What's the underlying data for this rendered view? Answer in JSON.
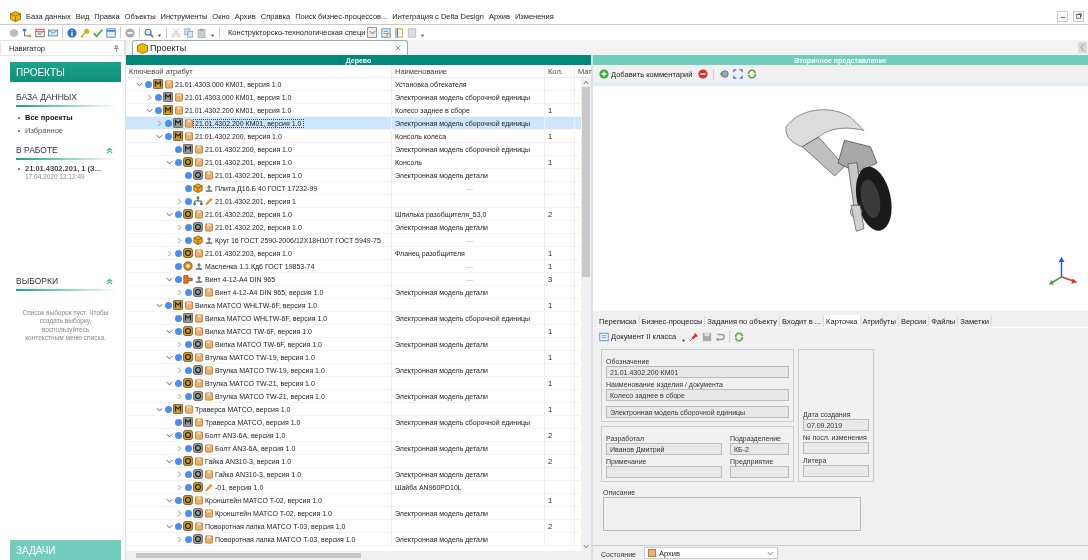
{
  "menu": [
    "База данных",
    "Вид",
    "Правка",
    "Объекты",
    "Инструменты",
    "Окно",
    "Архив",
    "Справка",
    "Поиск бизнес-процессов...",
    "Интеграция с Delta Design",
    "Архив",
    "Изменения"
  ],
  "toolbar": {
    "spec_select": "Конструкторско-технологическая специ"
  },
  "navigator": {
    "title": "Навигатор",
    "projects_header": "ПРОЕКТЫ",
    "database": {
      "title": "БАЗА ДАННЫХ",
      "items": [
        {
          "label": "Все проекты",
          "selected": true
        },
        {
          "label": "Избранное",
          "selected": false
        }
      ]
    },
    "in_work": {
      "title": "В РАБОТЕ",
      "items": [
        {
          "label": "21.01.4302.201, 1 (З...",
          "time": "17.04.2020 12:12:49"
        }
      ]
    },
    "selections": {
      "title": "ВЫБОРКИ",
      "empty_text": "Список выборок пуст. Чтобы создать выборку, воспользуйтесь контекстным меню списка."
    },
    "tasks_header": "ЗАДАЧИ"
  },
  "document_tab": {
    "title": "Проекты"
  },
  "tree": {
    "title": "Дерево",
    "columns": [
      "Ключевой атрибут",
      "Наименование",
      "Кол.",
      "Мат"
    ],
    "rows": [
      {
        "key": "21.01.4303.000 КМ01, версия 1.0",
        "name": "Установка обтекателя",
        "kind": "assembly",
        "expanded": true,
        "selected": false,
        "children": [
          {
            "key": "21.01.4303.000 КМ01, версия 1.0",
            "name": "Электронная модель сборочной единицы",
            "kind": "assembly-model",
            "expanded": false,
            "selected": false
          },
          {
            "key": "21.01.4302.200 КМ01, версия 1.0",
            "name": "Колесо заднее в сборе",
            "qty": "1",
            "kind": "assembly",
            "expanded": true,
            "selected": false,
            "children": [
              {
                "key": "21.01.4302.200 КМ01, версия 1.0",
                "name": "Электронная модель сборочной единицы",
                "kind": "assembly-model",
                "expanded": false,
                "selected": true
              },
              {
                "key": "21.01.4302.200, версия 1.0",
                "name": "Консоль колеса",
                "qty": "1",
                "kind": "assembly",
                "expanded": true,
                "selected": false,
                "children": [
                  {
                    "key": "21.01.4302.200, версия 1.0",
                    "name": "Электронная модель сборочной единицы",
                    "kind": "assembly-model",
                    "selected": false
                  },
                  {
                    "key": "21.01.4302.201, версия 1.0",
                    "name": "Консоль",
                    "qty": "1",
                    "kind": "part",
                    "expanded": true,
                    "selected": false,
                    "children": [
                      {
                        "key": "21.01.4302.201, версия 1.0",
                        "name": "Электронная модель детали",
                        "kind": "part-model",
                        "selected": false
                      },
                      {
                        "key": "Плита Д16.Б 40 ГОСТ 17232-99",
                        "name": "—",
                        "kind": "material",
                        "selected": false
                      },
                      {
                        "key": "21.01.4302.201, версия 1",
                        "kind": "structure",
                        "expanded": false,
                        "selected": false
                      }
                    ]
                  },
                  {
                    "key": "21.01.4302.202, версия 1.0",
                    "name": "Шпилька разобщителя_53,0",
                    "qty": "2",
                    "kind": "part",
                    "expanded": true,
                    "selected": false,
                    "children": [
                      {
                        "key": "21.01.4302.202, версия 1.0",
                        "name": "Электронная модель детали",
                        "kind": "part-model",
                        "expanded": false,
                        "selected": false
                      },
                      {
                        "key": "Круг 16 ГОСТ 2590-2006/12Х18Н10Т ГОСТ 5949-75",
                        "name": "—",
                        "kind": "material",
                        "expanded": false,
                        "selected": false
                      }
                    ]
                  },
                  {
                    "key": "21.01.4302.203, версия 1.0",
                    "name": "Фланец разобщителя",
                    "qty": "1",
                    "kind": "part",
                    "expanded": false,
                    "selected": false
                  },
                  {
                    "key": "Масленка 1.1.Кд6 ГОСТ 19853-74",
                    "name": "—",
                    "qty": "1",
                    "kind": "standard",
                    "selected": false
                  },
                  {
                    "key": "Винт 4-12-А4 DIN 965",
                    "name": "—",
                    "qty": "3",
                    "kind": "fastener",
                    "expanded": true,
                    "selected": false,
                    "children": [
                      {
                        "key": "Винт 4-12-А4 DIN 965, версия 1.0",
                        "name": "Электронная модель детали",
                        "kind": "part-model",
                        "expanded": false,
                        "selected": false
                      }
                    ]
                  }
                ]
              },
              {
                "key": "Вилка MATCO WHLTW-6F, версия 1.0",
                "qty": "1",
                "kind": "assembly",
                "expanded": true,
                "selected": false,
                "children": [
                  {
                    "key": "Вилка MATCO WHLTW-6F, версия 1.0",
                    "name": "Электронная модель сборочной единицы",
                    "kind": "assembly-model",
                    "selected": false
                  },
                  {
                    "key": "Вилка MATCO TW-6F, версия 1.0",
                    "qty": "1",
                    "kind": "part",
                    "expanded": true,
                    "selected": false,
                    "children": [
                      {
                        "key": "Вилка MATCO TW-6F, версия 1.0",
                        "name": "Электронная модель детали",
                        "kind": "part-model",
                        "expanded": false,
                        "selected": false
                      }
                    ]
                  },
                  {
                    "key": "Втулка MATCO TW-19, версия 1.0",
                    "qty": "1",
                    "kind": "part",
                    "expanded": true,
                    "selected": false,
                    "children": [
                      {
                        "key": "Втулка MATCO TW-19, версия 1.0",
                        "name": "Электронная модель детали",
                        "kind": "part-model",
                        "expanded": false,
                        "selected": false
                      }
                    ]
                  },
                  {
                    "key": "Втулка MATCO TW-21, версия 1.0",
                    "qty": "1",
                    "kind": "part",
                    "expanded": true,
                    "selected": false,
                    "children": [
                      {
                        "key": "Втулка MATCO TW-21, версия 1.0",
                        "name": "Электронная модель детали",
                        "kind": "part-model",
                        "expanded": false,
                        "selected": false
                      }
                    ]
                  }
                ]
              },
              {
                "key": "Траверса MATCO, версия 1.0",
                "qty": "1",
                "kind": "assembly",
                "expanded": true,
                "selected": false,
                "children": [
                  {
                    "key": "Траверса MATCO, версия 1.0",
                    "name": "Электронная модель сборочной единицы",
                    "kind": "assembly-model",
                    "selected": false
                  },
                  {
                    "key": "Болт AN3-6A, версия 1.0",
                    "qty": "2",
                    "kind": "part",
                    "expanded": true,
                    "selected": false,
                    "children": [
                      {
                        "key": "Болт AN3-6A, версия 1.0",
                        "name": "Электронная модель детали",
                        "kind": "part-model",
                        "expanded": false,
                        "selected": false
                      }
                    ]
                  },
                  {
                    "key": "Гайка AN310-3, версия 1.0",
                    "qty": "2",
                    "kind": "part",
                    "expanded": true,
                    "selected": false,
                    "children": [
                      {
                        "key": "Гайка AN310-3, версия 1.0",
                        "name": "Электронная модель детали",
                        "kind": "part-model",
                        "expanded": false,
                        "selected": false
                      },
                      {
                        "key": "-01, версия 1.0",
                        "name": "Шайба AN960PD10L",
                        "kind": "variant",
                        "expanded": false,
                        "selected": false
                      }
                    ]
                  },
                  {
                    "key": "Кронштейн MATCO T-02, версия 1.0",
                    "qty": "1",
                    "kind": "part",
                    "expanded": true,
                    "selected": false,
                    "children": [
                      {
                        "key": "Кронштейн MATCO T-02, версия 1.0",
                        "name": "Электронная модель детали",
                        "kind": "part-model",
                        "expanded": false,
                        "selected": false
                      }
                    ]
                  },
                  {
                    "key": "Поворотная лапка MATCO T-03, версия 1.0",
                    "qty": "2",
                    "kind": "part",
                    "expanded": true,
                    "selected": false,
                    "children": [
                      {
                        "key": "Поворотная лапка MATCO T-03, версия 1.0",
                        "name": "Электронная модель детали",
                        "kind": "part-model",
                        "expanded": false,
                        "selected": false
                      }
                    ]
                  }
                ]
              }
            ]
          }
        ]
      }
    ]
  },
  "secondary": {
    "title": "Вторичное представление",
    "add_comment": "Добавить комментарий",
    "tabs": [
      {
        "label": "Переписка",
        "selected": false
      },
      {
        "label": "Бизнес-процессы",
        "selected": false
      },
      {
        "label": "Задания по объекту",
        "selected": false
      },
      {
        "label": "Входит в ...",
        "selected": false
      },
      {
        "label": "Карточка",
        "selected": true
      },
      {
        "label": "Атрибуты",
        "selected": false
      },
      {
        "label": "Версии",
        "selected": false
      },
      {
        "label": "Файлы",
        "selected": false
      },
      {
        "label": "Заметки",
        "selected": false
      }
    ],
    "doc_class": "Документ II класса",
    "form": {
      "designation": {
        "label": "Обозначение",
        "value": "21.01.4302.200 КМ01"
      },
      "name": {
        "label": "Наименование изделия / документа",
        "value": "Колесо заднее в сборе",
        "value_2": "Электронная модель сборочной единицы"
      },
      "created": {
        "label": "Дата создания",
        "value": "07.09.2019"
      },
      "change_no": {
        "label": "№ посл. изменения"
      },
      "developer": {
        "label": "Разработал",
        "value": "Иванов Дмитрий"
      },
      "department": {
        "label": "Подразделение",
        "value": "КБ-2"
      },
      "note": {
        "label": "Примечание"
      },
      "enterprise": {
        "label": "Предприятие"
      },
      "litera": {
        "label": "Литера"
      },
      "description": {
        "label": "Описание"
      }
    },
    "state": {
      "label": "Состояние",
      "value": "Архив"
    }
  }
}
